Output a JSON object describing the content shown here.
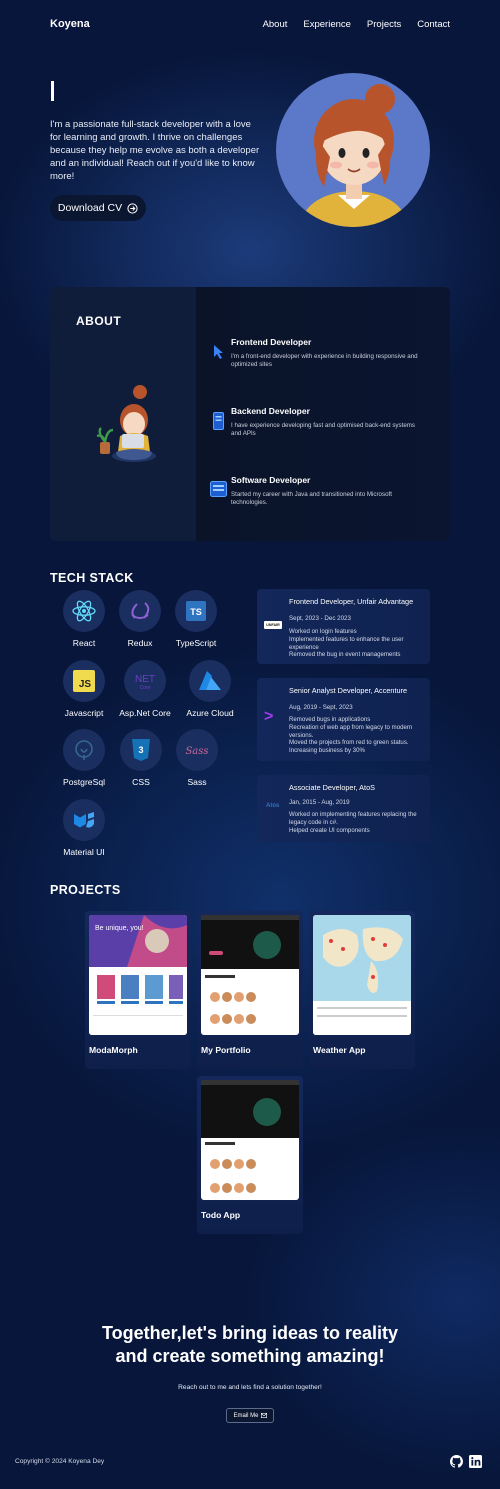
{
  "nav": {
    "brand": "Koyena",
    "links": [
      "About",
      "Experience",
      "Projects",
      "Contact"
    ]
  },
  "hero": {
    "intro": "I'm a passionate full-stack developer with a love for learning and growth. I thrive on challenges because they help me evolve as both a developer and an individual! Reach out if you'd like to know more!",
    "cv_button": "Download CV"
  },
  "about": {
    "title": "ABOUT",
    "roles": [
      {
        "title": "Frontend Developer",
        "desc": "I'm a front-end developer with experience in building responsive and optimized sites",
        "icon": "cursor-icon"
      },
      {
        "title": "Backend Developer",
        "desc": "I have experience developing fast and optimised back-end systems and APIs",
        "icon": "server-icon"
      },
      {
        "title": "Software Developer",
        "desc": "Started my career with Java and transitioned into Microsoft technologies.",
        "icon": "window-icon"
      }
    ]
  },
  "tech": {
    "title": "TECH STACK",
    "items": [
      {
        "label": "React",
        "icon": "react-icon"
      },
      {
        "label": "Redux",
        "icon": "redux-icon"
      },
      {
        "label": "TypeScript",
        "icon": "typescript-icon"
      },
      {
        "label": "Javascript",
        "icon": "javascript-icon"
      },
      {
        "label": "Asp.Net Core",
        "icon": "dotnet-icon"
      },
      {
        "label": "Azure Cloud",
        "icon": "azure-icon"
      },
      {
        "label": "PostgreSql",
        "icon": "postgresql-icon"
      },
      {
        "label": "CSS",
        "icon": "css-icon"
      },
      {
        "label": "Sass",
        "icon": "sass-icon"
      },
      {
        "label": "Material UI",
        "icon": "material-ui-icon"
      }
    ]
  },
  "experience": [
    {
      "title": "Frontend Developer, Unfair Advantage",
      "dates": "Sept, 2023 - Dec 2023",
      "notes": [
        "Worked on login features",
        "Implemented features to enhance the user experience",
        "Removed the bug in event managements"
      ],
      "logo": "UNFAIR"
    },
    {
      "title": "Senior Analyst Developer, Accenture",
      "dates": "Aug, 2019 - Sept, 2023",
      "notes": [
        "Removed bugs in applications",
        "Recreation of web app from legacy to modern versions.",
        "Moved the projects from red to green status.",
        "Increasing business by 30%"
      ],
      "logo": ">"
    },
    {
      "title": "Associate Developer, AtoS",
      "dates": "Jan, 2015 - Aug, 2019",
      "notes": [
        "Worked on implementing features replacing the legacy code in c#.",
        "Helped create UI components"
      ],
      "logo": "Atos"
    }
  ],
  "projects": {
    "title": "PROJECTS",
    "items": [
      {
        "name": "ModaMorph",
        "shot_headline": "Be unique, you!"
      },
      {
        "name": "My Portfolio",
        "shot_headline": ""
      },
      {
        "name": "Weather App",
        "shot_headline": ""
      },
      {
        "name": "Todo App",
        "shot_headline": ""
      }
    ]
  },
  "cta": {
    "line1": "Together,let's bring ideas to reality",
    "line2": "and create something amazing!",
    "sub": "Reach out to me and lets find a solution together!",
    "email_button": "Email Me"
  },
  "footer": {
    "copyright": "Copyright © 2024 Koyena Dey"
  },
  "colors": {
    "background": "#07163a",
    "card": "#13275a",
    "accent_blue": "#3b82f6"
  }
}
